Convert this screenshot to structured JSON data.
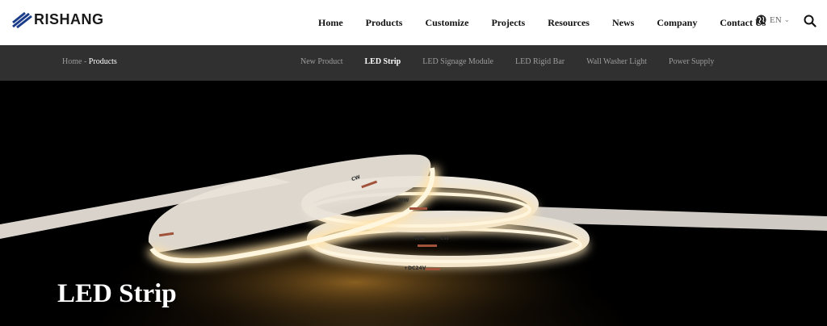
{
  "brand": {
    "name": "RISHANG"
  },
  "nav": {
    "items": [
      "Home",
      "Products",
      "Customize",
      "Projects",
      "Resources",
      "News",
      "Company",
      "Contact Us"
    ],
    "language": "EN"
  },
  "breadcrumb": {
    "home": "Home",
    "separator": " - ",
    "current": "Products"
  },
  "subnav": {
    "items": [
      "New Product",
      "LED Strip",
      "LED Signage Module",
      "LED Rigid Bar",
      "Wall Washer Light",
      "Power Supply"
    ],
    "active": "LED Strip"
  },
  "hero": {
    "title": "LED Strip",
    "strip_markings": {
      "cw": "CW",
      "ww": "WW",
      "voltage": "+DC24V"
    }
  },
  "colors": {
    "header_bg": "#ffffff",
    "subnav_bg": "#303030",
    "glow": "#ffe3b0",
    "accent_text": "#ffffff"
  },
  "icons": {
    "language": "globe-icon",
    "language_toggle": "chevron-down-icon",
    "search": "search-icon",
    "logo": "logo-icon"
  }
}
